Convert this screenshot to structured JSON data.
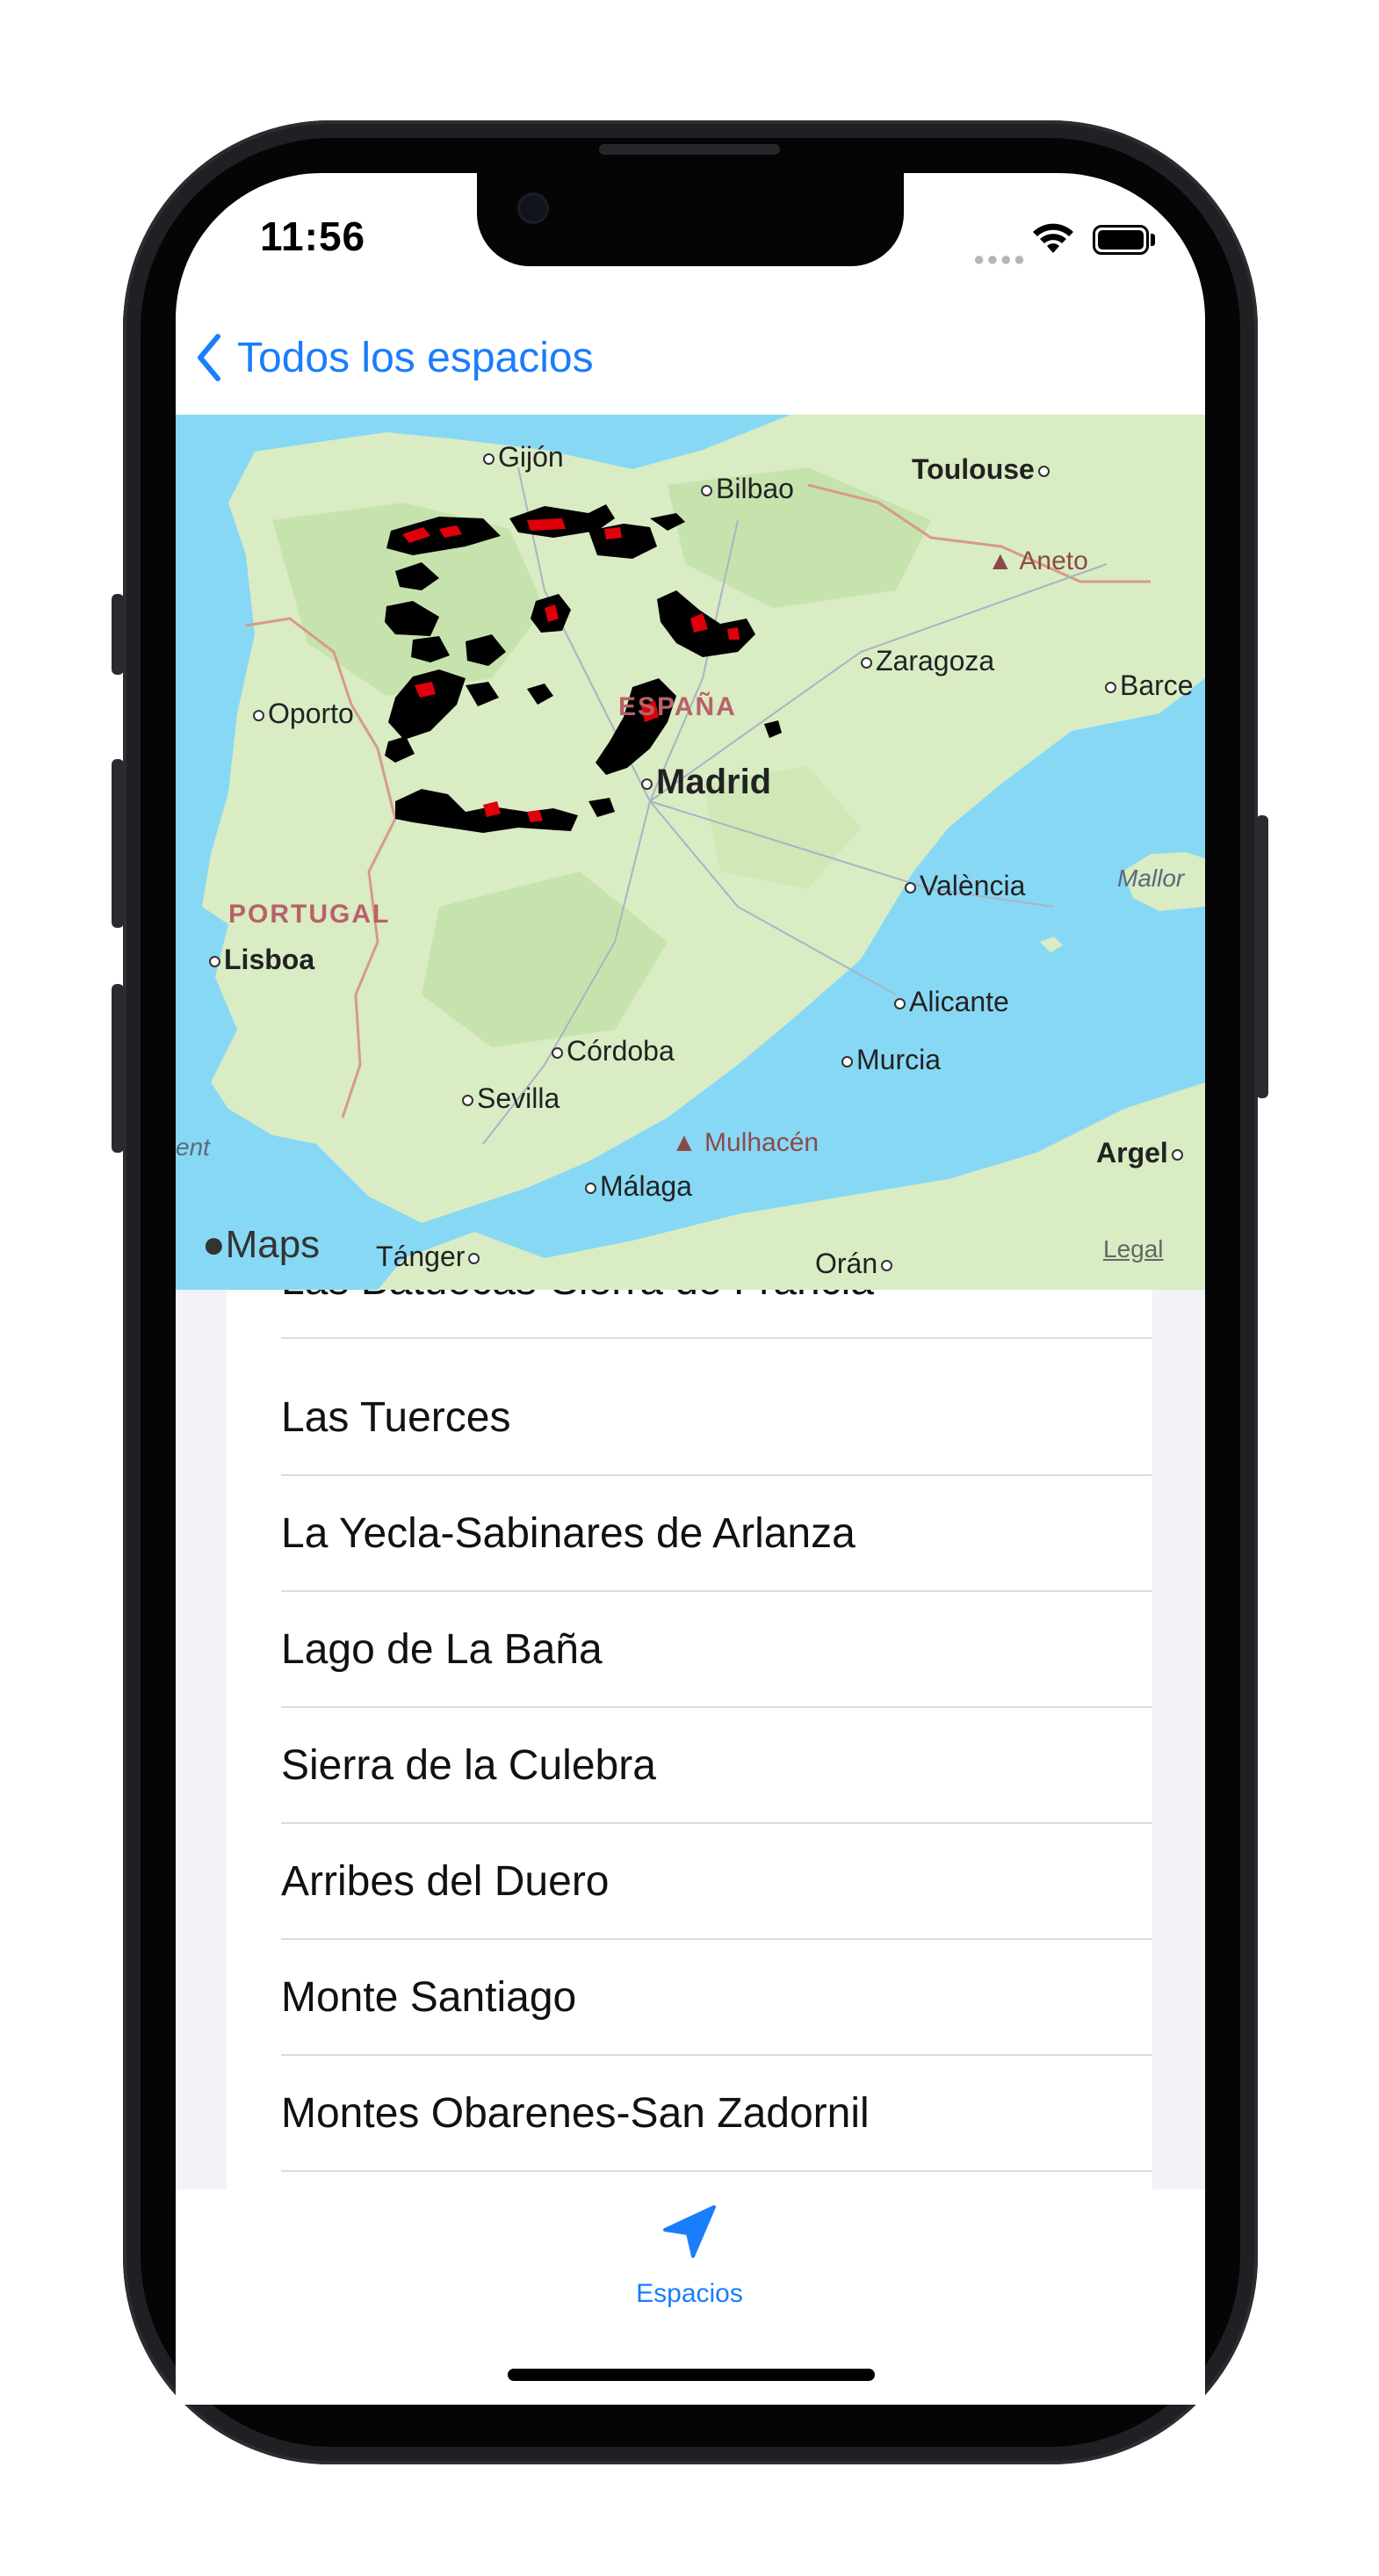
{
  "status_bar": {
    "time": "11:56"
  },
  "nav": {
    "back_label": "Todos los espacios"
  },
  "map": {
    "attribution": "Maps",
    "legal": "Legal",
    "places": {
      "gijon": "Gijón",
      "bilbao": "Bilbao",
      "toulouse": "Toulouse",
      "aneto": "Aneto",
      "zaragoza": "Zaragoza",
      "oporto": "Oporto",
      "espana": "ESPAÑA",
      "barce": "Barce",
      "madrid": "Madrid",
      "valencia": "València",
      "mallor": "Mallor",
      "portugal": "PORTUGAL",
      "lisboa": "Lisboa",
      "alicante": "Alicante",
      "cordoba": "Córdoba",
      "murcia": "Murcia",
      "sevilla": "Sevilla",
      "ent": "ent",
      "mulhacen": "Mulhacén",
      "argel": "Argel",
      "malaga": "Málaga",
      "tanger": "Tánger",
      "oran": "Orán"
    }
  },
  "list": {
    "items": [
      "Las Batuecas-Sierra de Francia",
      "Las Tuerces",
      "La Yecla-Sabinares de Arlanza",
      "Lago de La Baña",
      "Sierra de la Culebra",
      "Arribes del Duero",
      "Monte Santiago",
      "Montes Obarenes-San Zadornil"
    ]
  },
  "tabbar": {
    "tab_label": "Espacios"
  },
  "colors": {
    "accent": "#1a7dfb",
    "land": "#d6ecc0",
    "water": "#87d8f5",
    "overlay_fill": "#e0000b"
  }
}
